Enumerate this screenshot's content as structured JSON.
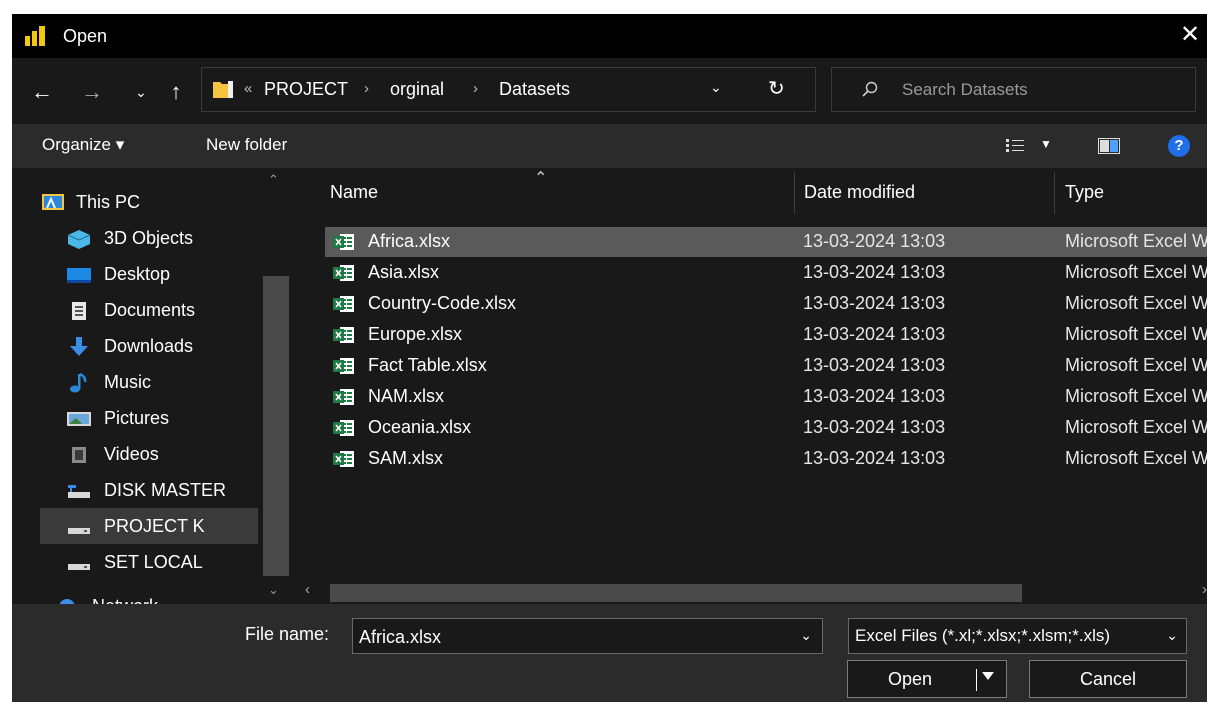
{
  "window": {
    "title": "Open"
  },
  "address": {
    "overflow": "«",
    "crumbs": [
      "PROJECT",
      "orginal",
      "Datasets"
    ],
    "separator": "›"
  },
  "search": {
    "placeholder": "Search Datasets"
  },
  "toolbar": {
    "organize": "Organize ▾",
    "new_folder": "New folder"
  },
  "sidebar": {
    "items": [
      {
        "label": "This PC",
        "icon": "pc-icon"
      },
      {
        "label": "3D Objects",
        "icon": "3d-objects-icon"
      },
      {
        "label": "Desktop",
        "icon": "desktop-icon"
      },
      {
        "label": "Documents",
        "icon": "documents-icon"
      },
      {
        "label": "Downloads",
        "icon": "downloads-icon"
      },
      {
        "label": "Music",
        "icon": "music-icon"
      },
      {
        "label": "Pictures",
        "icon": "pictures-icon"
      },
      {
        "label": "Videos",
        "icon": "videos-icon"
      },
      {
        "label": "DISK MASTER",
        "icon": "drive-icon"
      },
      {
        "label": "PROJECT K",
        "icon": "drive-icon"
      },
      {
        "label": "SET LOCAL",
        "icon": "drive-icon"
      },
      {
        "label": "Network",
        "icon": "network-icon"
      }
    ]
  },
  "columns": {
    "name": "Name",
    "date": "Date modified",
    "type": "Type"
  },
  "files": [
    {
      "name": "Africa.xlsx",
      "date": "13-03-2024 13:03",
      "type": "Microsoft Excel Worksheet"
    },
    {
      "name": "Asia.xlsx",
      "date": "13-03-2024 13:03",
      "type": "Microsoft Excel Worksheet"
    },
    {
      "name": "Country-Code.xlsx",
      "date": "13-03-2024 13:03",
      "type": "Microsoft Excel Worksheet"
    },
    {
      "name": "Europe.xlsx",
      "date": "13-03-2024 13:03",
      "type": "Microsoft Excel Worksheet"
    },
    {
      "name": "Fact Table.xlsx",
      "date": "13-03-2024 13:03",
      "type": "Microsoft Excel Worksheet"
    },
    {
      "name": "NAM.xlsx",
      "date": "13-03-2024 13:03",
      "type": "Microsoft Excel Worksheet"
    },
    {
      "name": "Oceania.xlsx",
      "date": "13-03-2024 13:03",
      "type": "Microsoft Excel Worksheet"
    },
    {
      "name": "SAM.xlsx",
      "date": "13-03-2024 13:03",
      "type": "Microsoft Excel Worksheet"
    }
  ],
  "footer": {
    "file_name_label": "File name:",
    "file_name_value": "Africa.xlsx",
    "file_type": "Excel Files (*.xl;*.xlsx;*.xlsm;*.xls)",
    "open": "Open",
    "cancel": "Cancel"
  },
  "colors": {
    "background": "#191919",
    "toolbar": "#2b2b2b",
    "selection": "#5a5a5a",
    "accent": "#1e6fe8",
    "excel_green": "#1d7a45"
  }
}
